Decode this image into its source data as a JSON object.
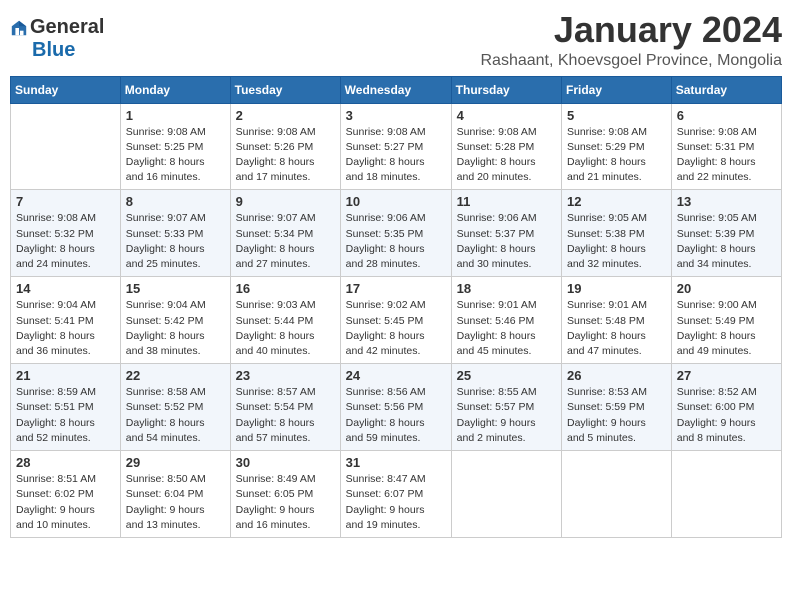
{
  "header": {
    "logo_general": "General",
    "logo_blue": "Blue",
    "month_title": "January 2024",
    "location": "Rashaant, Khoevsgoel Province, Mongolia"
  },
  "weekdays": [
    "Sunday",
    "Monday",
    "Tuesday",
    "Wednesday",
    "Thursday",
    "Friday",
    "Saturday"
  ],
  "weeks": [
    [
      {
        "day": "",
        "info": ""
      },
      {
        "day": "1",
        "info": "Sunrise: 9:08 AM\nSunset: 5:25 PM\nDaylight: 8 hours\nand 16 minutes."
      },
      {
        "day": "2",
        "info": "Sunrise: 9:08 AM\nSunset: 5:26 PM\nDaylight: 8 hours\nand 17 minutes."
      },
      {
        "day": "3",
        "info": "Sunrise: 9:08 AM\nSunset: 5:27 PM\nDaylight: 8 hours\nand 18 minutes."
      },
      {
        "day": "4",
        "info": "Sunrise: 9:08 AM\nSunset: 5:28 PM\nDaylight: 8 hours\nand 20 minutes."
      },
      {
        "day": "5",
        "info": "Sunrise: 9:08 AM\nSunset: 5:29 PM\nDaylight: 8 hours\nand 21 minutes."
      },
      {
        "day": "6",
        "info": "Sunrise: 9:08 AM\nSunset: 5:31 PM\nDaylight: 8 hours\nand 22 minutes."
      }
    ],
    [
      {
        "day": "7",
        "info": "Sunrise: 9:08 AM\nSunset: 5:32 PM\nDaylight: 8 hours\nand 24 minutes."
      },
      {
        "day": "8",
        "info": "Sunrise: 9:07 AM\nSunset: 5:33 PM\nDaylight: 8 hours\nand 25 minutes."
      },
      {
        "day": "9",
        "info": "Sunrise: 9:07 AM\nSunset: 5:34 PM\nDaylight: 8 hours\nand 27 minutes."
      },
      {
        "day": "10",
        "info": "Sunrise: 9:06 AM\nSunset: 5:35 PM\nDaylight: 8 hours\nand 28 minutes."
      },
      {
        "day": "11",
        "info": "Sunrise: 9:06 AM\nSunset: 5:37 PM\nDaylight: 8 hours\nand 30 minutes."
      },
      {
        "day": "12",
        "info": "Sunrise: 9:05 AM\nSunset: 5:38 PM\nDaylight: 8 hours\nand 32 minutes."
      },
      {
        "day": "13",
        "info": "Sunrise: 9:05 AM\nSunset: 5:39 PM\nDaylight: 8 hours\nand 34 minutes."
      }
    ],
    [
      {
        "day": "14",
        "info": "Sunrise: 9:04 AM\nSunset: 5:41 PM\nDaylight: 8 hours\nand 36 minutes."
      },
      {
        "day": "15",
        "info": "Sunrise: 9:04 AM\nSunset: 5:42 PM\nDaylight: 8 hours\nand 38 minutes."
      },
      {
        "day": "16",
        "info": "Sunrise: 9:03 AM\nSunset: 5:44 PM\nDaylight: 8 hours\nand 40 minutes."
      },
      {
        "day": "17",
        "info": "Sunrise: 9:02 AM\nSunset: 5:45 PM\nDaylight: 8 hours\nand 42 minutes."
      },
      {
        "day": "18",
        "info": "Sunrise: 9:01 AM\nSunset: 5:46 PM\nDaylight: 8 hours\nand 45 minutes."
      },
      {
        "day": "19",
        "info": "Sunrise: 9:01 AM\nSunset: 5:48 PM\nDaylight: 8 hours\nand 47 minutes."
      },
      {
        "day": "20",
        "info": "Sunrise: 9:00 AM\nSunset: 5:49 PM\nDaylight: 8 hours\nand 49 minutes."
      }
    ],
    [
      {
        "day": "21",
        "info": "Sunrise: 8:59 AM\nSunset: 5:51 PM\nDaylight: 8 hours\nand 52 minutes."
      },
      {
        "day": "22",
        "info": "Sunrise: 8:58 AM\nSunset: 5:52 PM\nDaylight: 8 hours\nand 54 minutes."
      },
      {
        "day": "23",
        "info": "Sunrise: 8:57 AM\nSunset: 5:54 PM\nDaylight: 8 hours\nand 57 minutes."
      },
      {
        "day": "24",
        "info": "Sunrise: 8:56 AM\nSunset: 5:56 PM\nDaylight: 8 hours\nand 59 minutes."
      },
      {
        "day": "25",
        "info": "Sunrise: 8:55 AM\nSunset: 5:57 PM\nDaylight: 9 hours\nand 2 minutes."
      },
      {
        "day": "26",
        "info": "Sunrise: 8:53 AM\nSunset: 5:59 PM\nDaylight: 9 hours\nand 5 minutes."
      },
      {
        "day": "27",
        "info": "Sunrise: 8:52 AM\nSunset: 6:00 PM\nDaylight: 9 hours\nand 8 minutes."
      }
    ],
    [
      {
        "day": "28",
        "info": "Sunrise: 8:51 AM\nSunset: 6:02 PM\nDaylight: 9 hours\nand 10 minutes."
      },
      {
        "day": "29",
        "info": "Sunrise: 8:50 AM\nSunset: 6:04 PM\nDaylight: 9 hours\nand 13 minutes."
      },
      {
        "day": "30",
        "info": "Sunrise: 8:49 AM\nSunset: 6:05 PM\nDaylight: 9 hours\nand 16 minutes."
      },
      {
        "day": "31",
        "info": "Sunrise: 8:47 AM\nSunset: 6:07 PM\nDaylight: 9 hours\nand 19 minutes."
      },
      {
        "day": "",
        "info": ""
      },
      {
        "day": "",
        "info": ""
      },
      {
        "day": "",
        "info": ""
      }
    ]
  ]
}
